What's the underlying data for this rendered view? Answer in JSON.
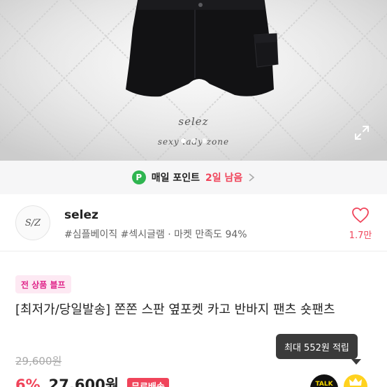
{
  "hero": {
    "logo_line1": "selez",
    "logo_line2": "sexy lady zone",
    "dots_count": 3,
    "active_dot": 0
  },
  "point_banner": {
    "badge": "P",
    "text": "매일 포인트",
    "days_left": "2일 남음"
  },
  "seller": {
    "avatar_text": "S/Z",
    "name": "selez",
    "tags": "#심플베이직 #섹시글램 · 마켓 만족도 94%",
    "like_count": "1.7만"
  },
  "product": {
    "promo_tag": "전 상품 블프",
    "title": "[최저가/당일발송] 쫀쫀 스판 옆포켓 카고 반바지 팬츠 숏팬츠",
    "original_price": "29,600원",
    "discount": "6%",
    "price": "27,600원",
    "shipping": "무료배송"
  },
  "reward_tooltip": "최대 552원 적립",
  "talk_label": "TALK",
  "colors": {
    "accent_red": "#f0445a",
    "point_green": "#2fb550",
    "promo_pink": "#e0258a",
    "tooltip_bg": "#3a3a3a"
  }
}
